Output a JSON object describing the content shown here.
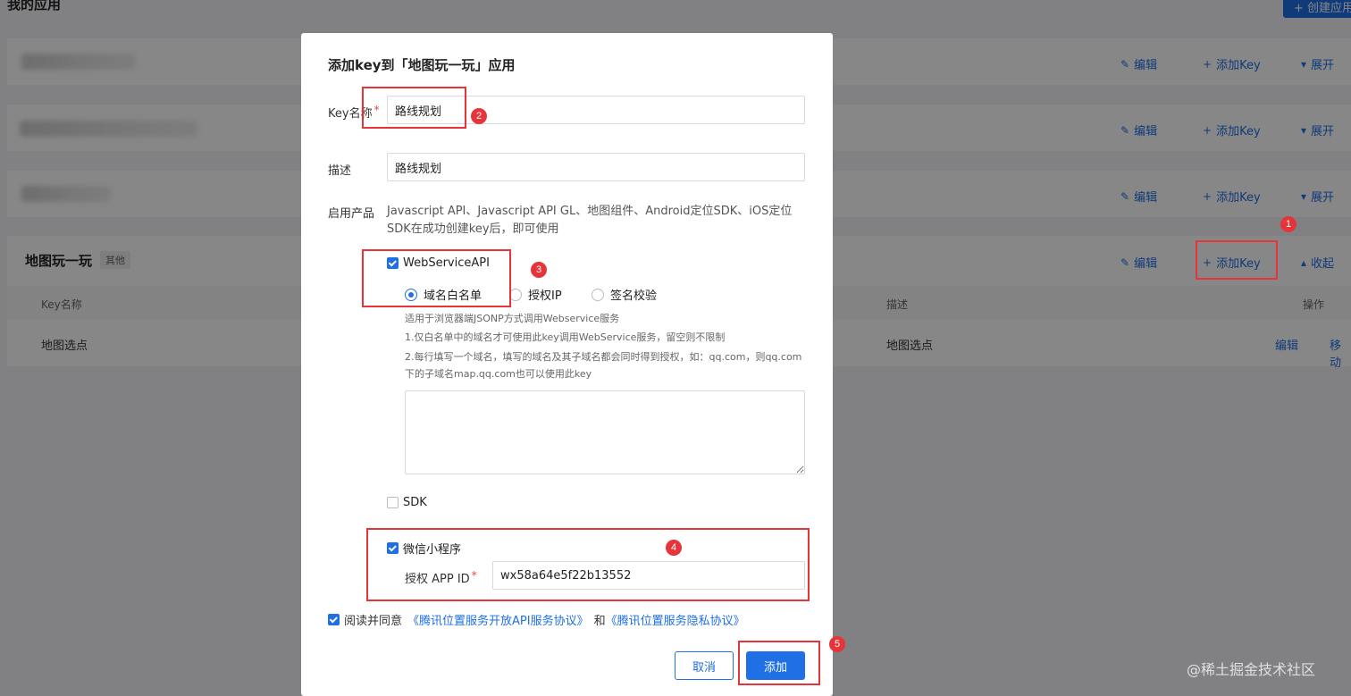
{
  "page": {
    "title": "我的应用",
    "create_button": "+ 创建应用"
  },
  "apps": {
    "actions": {
      "edit": "编辑",
      "add_key": "添加Key",
      "expand": "展开",
      "collapse": "收起"
    },
    "active": {
      "name": "地图玩一玩",
      "tag": "其他",
      "columns": {
        "key_name": "Key名称",
        "desc": "描述",
        "ops": "操作"
      },
      "rows": [
        {
          "key_name": "地图选点",
          "desc": "地图选点",
          "op_edit": "编辑",
          "op_move": "移动"
        }
      ]
    }
  },
  "modal": {
    "title": "添加key到「地图玩一玩」应用",
    "key_name_label": "Key名称",
    "key_name_value": "路线规划",
    "desc_label": "描述",
    "desc_value": "路线规划",
    "product_label": "启用产品",
    "product_desc": "Javascript API、Javascript API GL、地图组件、Android定位SDK、iOS定位SDK在成功创建key后，即可使用",
    "webservice": {
      "label": "WebServiceAPI",
      "checked": true,
      "radios": [
        "域名白名单",
        "授权IP",
        "签名校验"
      ],
      "selected": "域名白名单",
      "notes": [
        "适用于浏览器端JSONP方式调用Webservice服务",
        "1.仅白名单中的域名才可使用此key调用WebService服务，留空则不限制",
        "2.每行填写一个域名，填写的域名及其子域名都会同时得到授权，如：qq.com，则qq.com下的子域名map.qq.com也可以使用此key"
      ]
    },
    "sdk": {
      "label": "SDK",
      "checked": false
    },
    "miniprogram": {
      "label": "微信小程序",
      "checked": true,
      "appid_label": "授权 APP ID",
      "appid_value": "wx58a64e5f22b13552"
    },
    "agreement": {
      "prefix": "阅读并同意",
      "link1": "《腾讯位置服务开放API服务协议》",
      "and": "和",
      "link2": "《腾讯位置服务隐私协议》",
      "checked": true
    },
    "cancel": "取消",
    "add": "添加"
  },
  "annotations": [
    "1",
    "2",
    "3",
    "4",
    "5"
  ],
  "watermark": "@稀土掘金技术社区",
  "colors": {
    "primary": "#1f6fe5",
    "annotation": "#e5353a"
  }
}
